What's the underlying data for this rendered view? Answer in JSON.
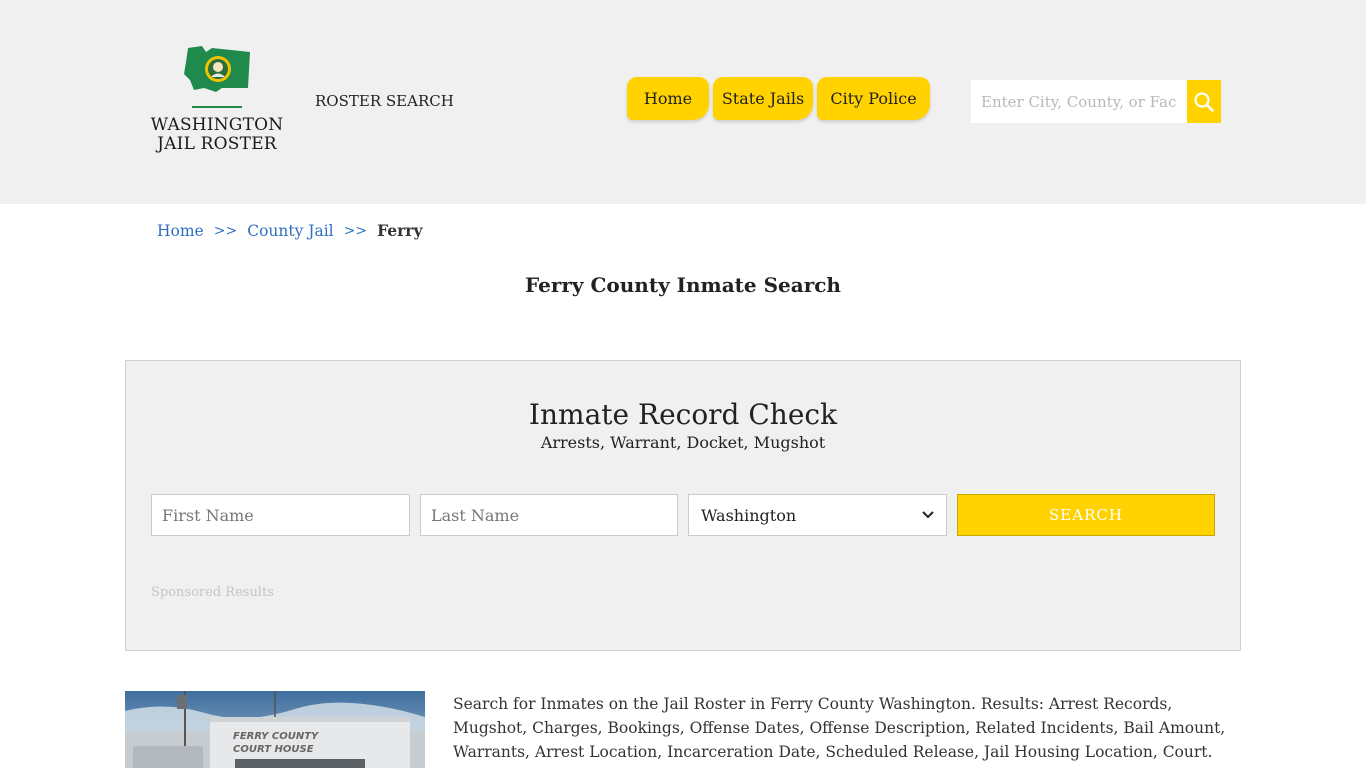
{
  "header": {
    "logo": {
      "line1": "WASHINGTON",
      "line2": "JAIL ROSTER"
    },
    "roster_search": "ROSTER SEARCH",
    "nav": [
      {
        "label": "Home"
      },
      {
        "label": "State Jails"
      },
      {
        "label": "City Police"
      }
    ],
    "search": {
      "placeholder": "Enter City, County, or Facility"
    },
    "colors": {
      "accent": "#ffd200",
      "header_bg": "#f0f0f0",
      "link": "#2e6fc0"
    }
  },
  "breadcrumb": {
    "items": [
      "Home",
      "County Jail"
    ],
    "separator": ">>",
    "current": "Ferry"
  },
  "page_title": "Ferry County Inmate Search",
  "record_check": {
    "title": "Inmate Record Check",
    "subtitle": "Arrests, Warrant, Docket, Mugshot",
    "first_name_placeholder": "First Name",
    "last_name_placeholder": "Last Name",
    "state_selected": "Washington",
    "search_label": "SEARCH",
    "sponsored": "Sponsored Results"
  },
  "photo": {
    "sign_line1": "FERRY COUNTY",
    "sign_line2": "COURT HOUSE"
  },
  "description": "Search for Inmates on the Jail Roster in Ferry County Washington. Results: Arrest Records, Mugshot, Charges, Bookings, Offense Dates, Offense Description, Related Incidents, Bail Amount, Warrants, Arrest Location, Incarceration Date, Scheduled Release, Jail Housing Location, Court."
}
